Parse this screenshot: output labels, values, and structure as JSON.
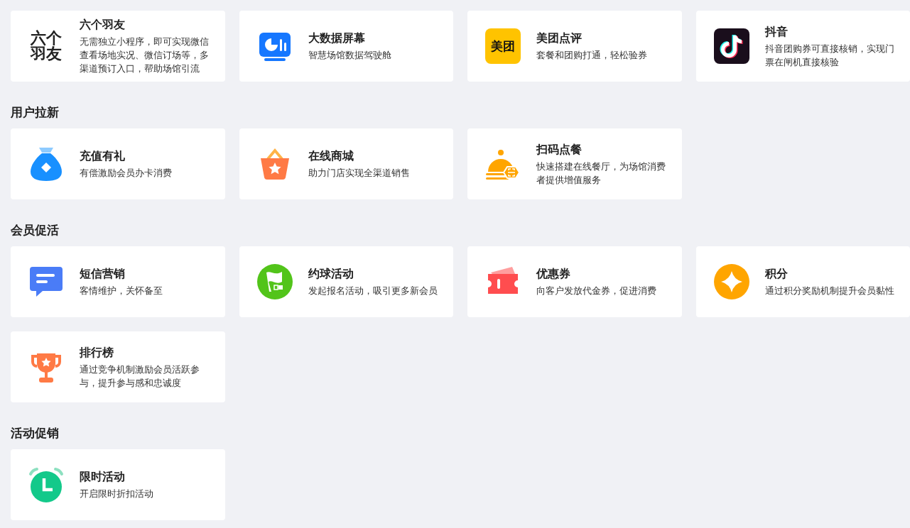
{
  "sections": [
    {
      "cards": [
        {
          "kind": "logo-text",
          "logo_text": "六个羽友",
          "title": "六个羽友",
          "description": "无需独立小程序，即可实现微信查看场地实况、微信订场等，多渠道预订入口，帮助场馆引流"
        },
        {
          "kind": "screen",
          "title": "大数据屏幕",
          "description": "智慧场馆数据驾驶舱"
        },
        {
          "kind": "yellow-logo",
          "logo_text": "美团",
          "title": "美团点评",
          "description": "套餐和团购打通，轻松验券"
        },
        {
          "kind": "note",
          "title": "抖音",
          "description": "抖音团购券可直接核销，实现门票在闸机直接核验"
        }
      ]
    },
    {
      "title": "用户拉新",
      "cards": [
        {
          "kind": "bag",
          "title": "充值有礼",
          "description": "有偿激励会员办卡消费"
        },
        {
          "kind": "basket",
          "title": "在线商城",
          "description": "助力门店实现全渠道销售"
        },
        {
          "kind": "cloche",
          "title": "扫码点餐",
          "description": "快速搭建在线餐厅，为场馆消费者提供增值服务"
        }
      ]
    },
    {
      "title": "会员促活",
      "cards": [
        {
          "kind": "chat",
          "title": "短信营销",
          "description": "客情维护，关怀备至"
        },
        {
          "kind": "flag",
          "title": "约球活动",
          "description": "发起报名活动，吸引更多新会员"
        },
        {
          "kind": "coupon",
          "title": "优惠券",
          "description": "向客户发放代金券，促进消费"
        },
        {
          "kind": "coin",
          "title": "积分",
          "description": "通过积分奖励机制提升会员黏性"
        },
        {
          "kind": "trophy",
          "title": "排行榜",
          "description": "通过竞争机制激励会员活跃参与，提升参与感和忠诚度"
        }
      ]
    },
    {
      "title": "活动促销",
      "cards": [
        {
          "kind": "alarm",
          "title": "限时活动",
          "description": "开启限时折扣活动"
        }
      ]
    }
  ]
}
